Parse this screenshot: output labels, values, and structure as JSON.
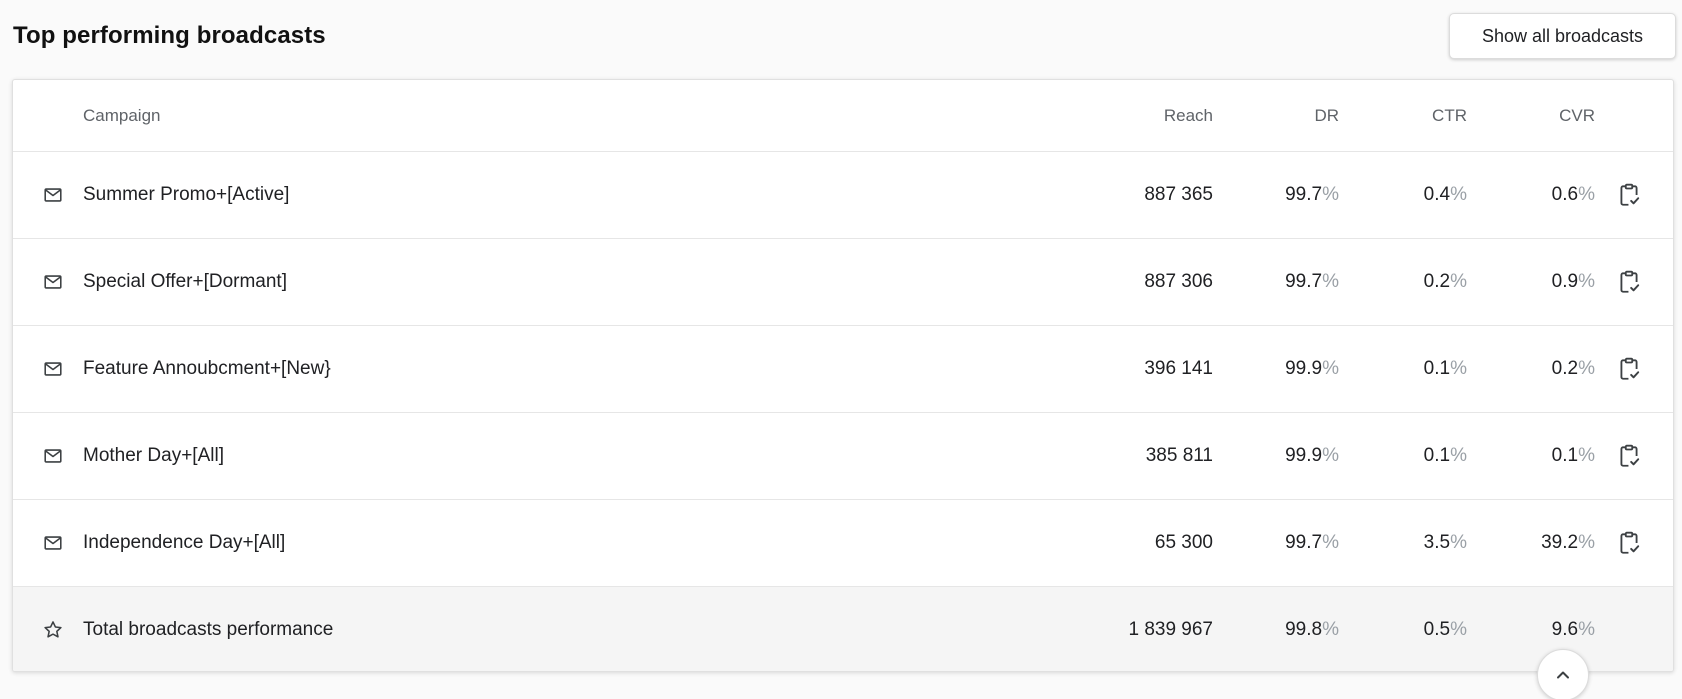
{
  "header": {
    "title": "Top performing broadcasts",
    "show_all_label": "Show all broadcasts"
  },
  "table": {
    "columns": {
      "campaign": "Campaign",
      "reach": "Reach",
      "dr": "DR",
      "ctr": "CTR",
      "cvr": "CVR"
    },
    "percent_sign": "%",
    "rows": [
      {
        "icon": "mail-icon",
        "name": "Summer Promo+[Active]",
        "reach": "887 365",
        "dr": "99.7",
        "ctr": "0.4",
        "cvr": "0.6",
        "action_icon": "clipboard-check-icon"
      },
      {
        "icon": "mail-icon",
        "name": "Special Offer+[Dormant]",
        "reach": "887 306",
        "dr": "99.7",
        "ctr": "0.2",
        "cvr": "0.9",
        "action_icon": "clipboard-check-icon"
      },
      {
        "icon": "mail-icon",
        "name": "Feature Annoubcment+[New}",
        "reach": "396 141",
        "dr": "99.9",
        "ctr": "0.1",
        "cvr": "0.2",
        "action_icon": "clipboard-check-icon"
      },
      {
        "icon": "mail-icon",
        "name": "Mother Day+[All]",
        "reach": "385 811",
        "dr": "99.9",
        "ctr": "0.1",
        "cvr": "0.1",
        "action_icon": "clipboard-check-icon"
      },
      {
        "icon": "mail-icon",
        "name": "Independence Day+[All]",
        "reach": "65 300",
        "dr": "99.7",
        "ctr": "3.5",
        "cvr": "39.2",
        "action_icon": "clipboard-check-icon"
      }
    ],
    "total": {
      "icon": "star-icon",
      "name": "Total broadcasts performance",
      "reach": "1 839 967",
      "dr": "99.8",
      "ctr": "0.5",
      "cvr": "9.6"
    }
  },
  "scroll_top_icon": "chevron-up-icon",
  "colors": {
    "text": "#202124",
    "muted": "#5f6368",
    "percent": "#9aa0a6",
    "total_row_bg": "#f5f5f5"
  }
}
